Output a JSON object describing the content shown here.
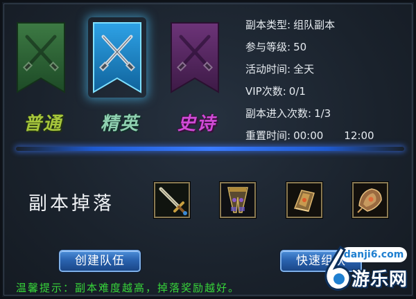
{
  "difficulties": [
    {
      "label": "普通",
      "color": "#a6c63c"
    },
    {
      "label": "精英",
      "color": "#8fd0b0",
      "selected": true
    },
    {
      "label": "史诗",
      "color": "#d04ad6"
    }
  ],
  "info": {
    "type_label": "副本类型:",
    "type_value": "组队副本",
    "level_label": "参与等级:",
    "level_value": "50",
    "time_label": "活动时间:",
    "time_value": "全天",
    "vip_label": "VIP次数:",
    "vip_value": "0/1",
    "entries_label": "副本进入次数:",
    "entries_value": "1/3",
    "reset_label": "重置时间:",
    "reset_value_1": "00:00",
    "reset_value_2": "12:00"
  },
  "drops": {
    "title": "副本掉落",
    "items": [
      "sword-icon",
      "leg-armor-icon",
      "bracer-icon",
      "shoulder-armor-icon"
    ]
  },
  "buttons": {
    "create_team": "创建队伍",
    "quick_team": "快速组队"
  },
  "tip": "温馨提示：副本难度越高，掉落奖励越好。",
  "watermark": {
    "site": "danji6.com",
    "brand": "游乐网",
    "digit": "6"
  },
  "colors": {
    "accent_blue": "#3b7cff",
    "tip_green": "#37d63a",
    "banner_green": "#2f6b3a",
    "banner_blue": "#1e86c8",
    "banner_purple": "#5a2a66"
  }
}
